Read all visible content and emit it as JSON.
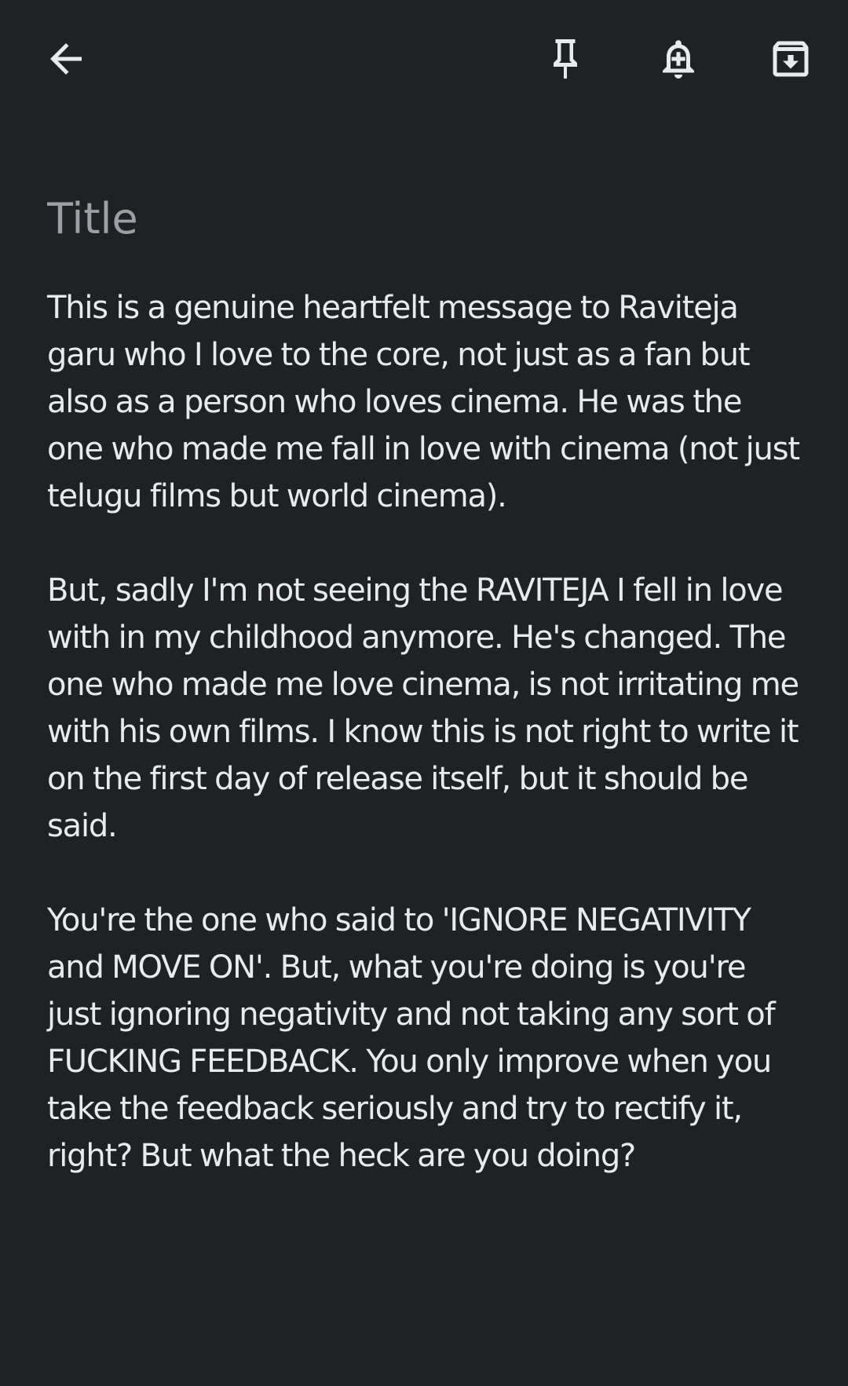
{
  "toolbar": {
    "back_icon": "arrow-left-icon",
    "pin_icon": "pushpin-icon",
    "reminder_icon": "add-alert-icon",
    "archive_icon": "archive-icon"
  },
  "note": {
    "title_value": "",
    "title_placeholder": "Title",
    "paragraphs": [
      "This is a genuine heartfelt message to Raviteja garu who I love to the core, not just as a fan but also as a person who loves cinema. He was the one who made me fall in love with cinema (not just telugu films but world cinema).",
      "But, sadly I'm not seeing the RAVITEJA I fell in love with in my childhood anymore. He's changed. The one who made me love cinema, is not irritating me with his own films. I know this is not right to write it on the first day of release itself, but it should be said.",
      "You're the one who said to 'IGNORE NEGATIVITY and MOVE ON'. But, what you're doing is you're just ignoring negativity and not taking any sort of FUCKING FEEDBACK. You only improve when you take the feedback seriously and try to rectify it, right? But what the heck are you doing?"
    ]
  },
  "colors": {
    "background": "#202124",
    "text": "#e8eaed",
    "placeholder": "#9aa0a6"
  }
}
